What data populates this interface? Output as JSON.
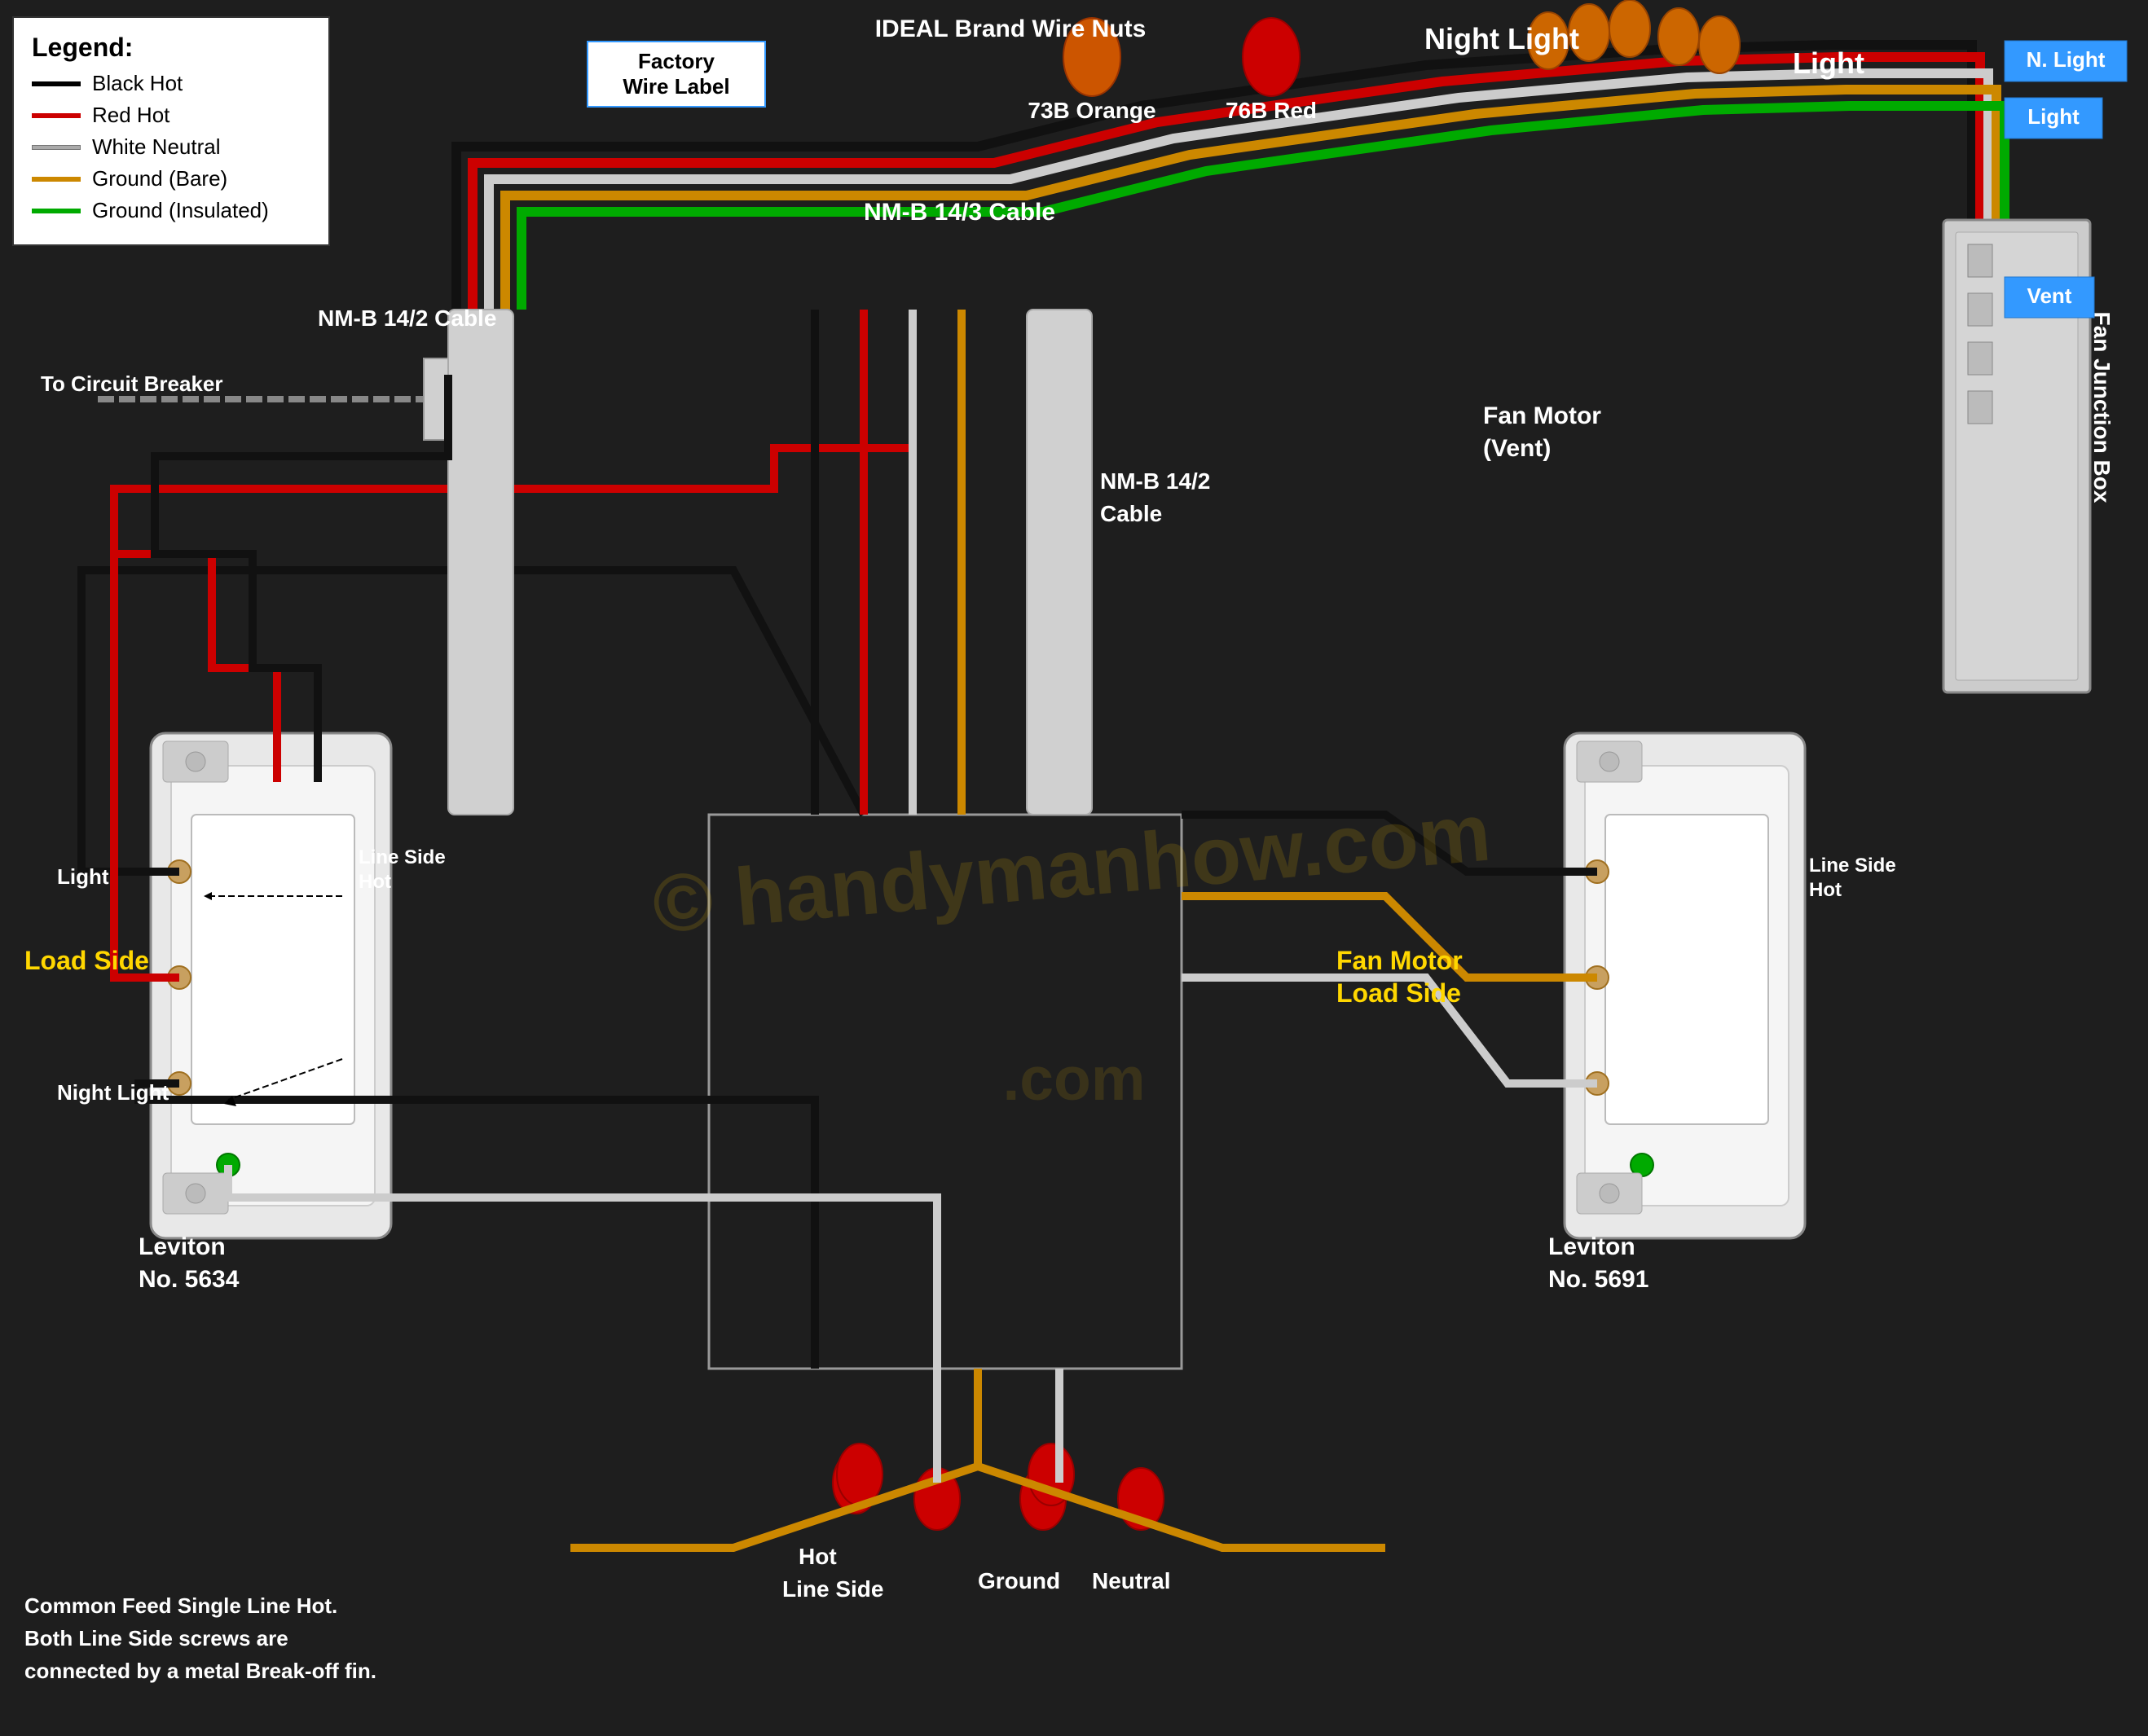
{
  "legend": {
    "title": "Legend:",
    "items": [
      {
        "label": "Black Hot",
        "color": "#000000"
      },
      {
        "label": "Red Hot",
        "color": "#cc0000"
      },
      {
        "label": "White Neutral",
        "color": "#cccccc"
      },
      {
        "label": "Ground (Bare)",
        "color": "#cc8800"
      },
      {
        "label": "Ground (Insulated)",
        "color": "#00aa00"
      }
    ]
  },
  "factory_label": {
    "line1": "Factory",
    "line2": "Wire Label"
  },
  "ideal_brand": {
    "title": "IDEAL Brand Wire Nuts",
    "nut1": "73B Orange",
    "nut2": "76B Red"
  },
  "cables": {
    "nmb_143": "NM-B 14/3 Cable",
    "nmb_142_top": "NM-B 14/2 Cable",
    "nmb_142_mid": "NM-B 14/2\nCable",
    "circuit_breaker": "To Circuit Breaker"
  },
  "switches": {
    "left": {
      "model": "Leviton",
      "number": "No. 5634",
      "light_label": "Light",
      "night_light_label": "Night Light",
      "load_side": "Load Side",
      "line_side_hot": "Line Side\nHot"
    },
    "right": {
      "model": "Leviton",
      "number": "No. 5691",
      "fan_motor_load": "Fan Motor\nLoad Side",
      "line_side_hot": "Line Side\nHot"
    }
  },
  "junction_box": {
    "label": "Fan Junction Box"
  },
  "labels": {
    "night_light": "Night Light",
    "light": "Light",
    "n_light": "N. Light",
    "light2": "Light",
    "vent": "Vent",
    "fan_motor_vent": "Fan Motor\n(Vent)",
    "hot_line_side": "Hot\nLine Side",
    "ground": "Ground",
    "neutral": "Neutral"
  },
  "footer_text": "Common Feed Single Line Hot.\nBoth Line Side screws are\nconnected by a metal Break-off fin.",
  "watermark": "© handymanhow.com",
  "copyright": "© handymanhow.com"
}
